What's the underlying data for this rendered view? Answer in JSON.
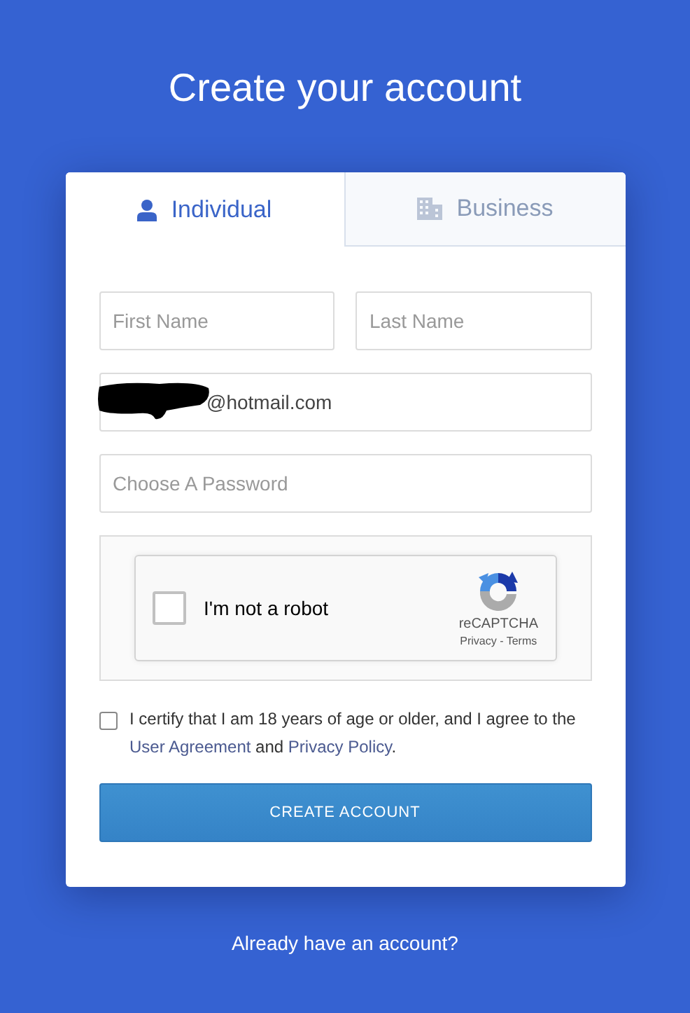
{
  "title": "Create your account",
  "tabs": [
    {
      "label": "Individual",
      "kind": "person",
      "selected": true
    },
    {
      "label": "Business",
      "kind": "building",
      "selected": false
    }
  ],
  "fields": {
    "first_name": {
      "placeholder": "First Name"
    },
    "last_name": {
      "placeholder": "Last Name"
    },
    "email": {
      "value": "@hotmail.com",
      "redacted": true
    },
    "password": {
      "placeholder": "Choose A Password"
    }
  },
  "captcha": {
    "label": "I'm not a robot",
    "checked": false,
    "brand": "reCAPTCHA",
    "privacy": "Privacy",
    "separator": " - ",
    "terms": "Terms"
  },
  "consent": {
    "checked": false,
    "text": "I certify that I am 18 years of age or older, and I agree to the ",
    "link_1": "User Agreement",
    "middle": " and ",
    "link_2": "Privacy Policy",
    "end": "."
  },
  "submit": "CREATE ACCOUNT",
  "footer_link": "Already have an account?"
}
